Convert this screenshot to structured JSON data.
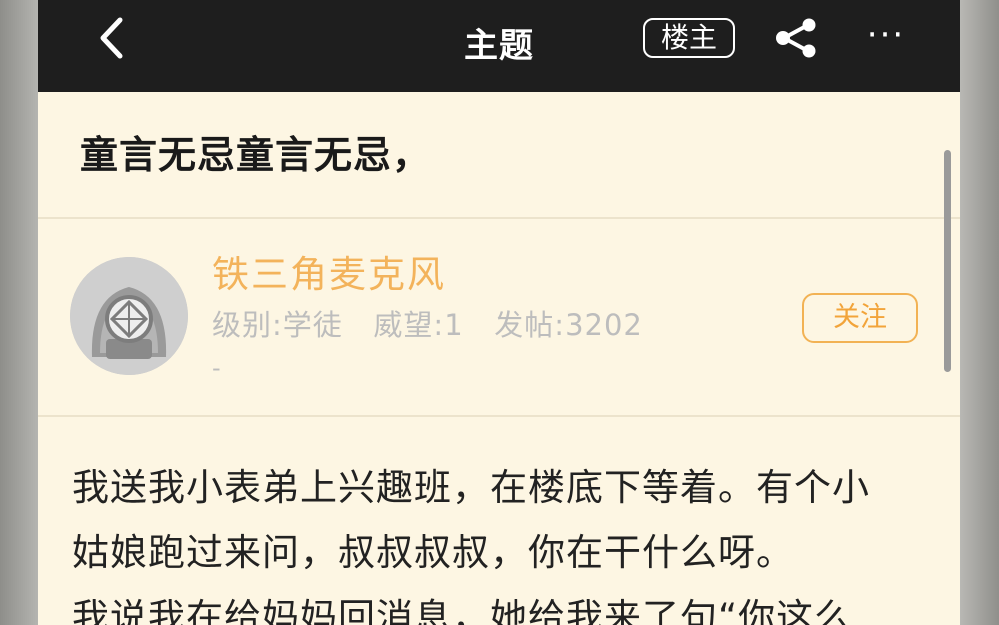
{
  "topbar": {
    "title": "主题",
    "louzhu_label": "楼主",
    "back_icon": "chevron-left-icon",
    "share_icon": "share-icon",
    "more_icon": "more-horizontal-icon",
    "more_glyph": "···"
  },
  "post": {
    "title": "童言无忌童言无忌，"
  },
  "author": {
    "name": "铁三角麦克风",
    "meta": "级别:学徒   威望:1   发帖:3202",
    "extra": "-",
    "follow_label": "关注",
    "name_color": "#f3b35b",
    "accent_color": "#f2a43a"
  },
  "content": {
    "lines": [
      "我送我小表弟上兴趣班，在楼底下等着。有个小",
      "姑娘跑过来问，叔叔叔叔，你在干什么呀。",
      "我说我在给妈妈回消息，她给我来了句“你这么"
    ]
  },
  "colors": {
    "topbar_bg": "#1e1e1e",
    "page_bg": "#fdf6e3"
  }
}
